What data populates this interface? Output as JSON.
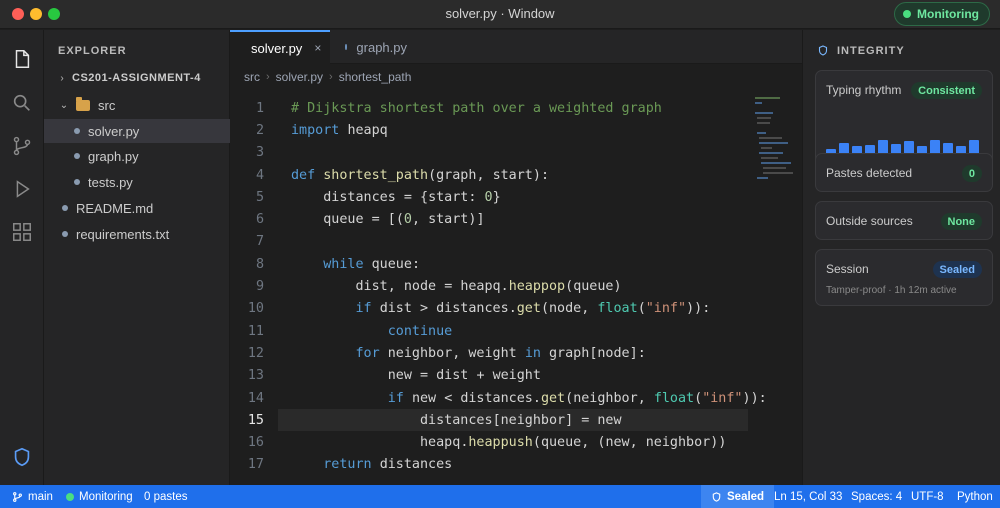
{
  "window": {
    "title": "solver.py · Window",
    "monitoring_label": "Monitoring"
  },
  "activity_bar": {
    "icons": [
      "files-icon",
      "search-icon",
      "source-control-icon",
      "run-icon",
      "extensions-icon",
      "shield-icon"
    ]
  },
  "explorer": {
    "title": "EXPLORER",
    "project": "CS201-ASSIGNMENT-4",
    "items": [
      {
        "label": "src",
        "type": "folder"
      },
      {
        "label": "solver.py",
        "type": "file",
        "active": true
      },
      {
        "label": "graph.py",
        "type": "file"
      },
      {
        "label": "tests.py",
        "type": "file"
      },
      {
        "label": "README.md",
        "type": "file"
      },
      {
        "label": "requirements.txt",
        "type": "file"
      }
    ]
  },
  "tabs": [
    {
      "label": "solver.py",
      "close": "×"
    },
    {
      "label": "graph.py"
    }
  ],
  "breadcrumb": [
    "src",
    "solver.py",
    "shortest_path"
  ],
  "editor": {
    "current_line": 15,
    "lines": [
      "# Dijkstra shortest path over a weighted graph",
      "import heapq",
      "",
      "def shortest_path(graph, start):",
      "    distances = {start: 0}",
      "    queue = [(0, start)]",
      "",
      "    while queue:",
      "        dist, node = heapq.heappop(queue)",
      "        if dist > distances.get(node, float(\"inf\")):",
      "            continue",
      "        for neighbor, weight in graph[node]:",
      "            new = dist + weight",
      "            if new < distances.get(neighbor, float(\"inf\")):",
      "                distances[neighbor] = new",
      "                heapq.heappush(queue, (new, neighbor))",
      "    return distances"
    ]
  },
  "integrity": {
    "title": "INTEGRITY",
    "typing": {
      "label": "Typing rhythm",
      "badge": "Consistent",
      "levels": [
        0.45,
        0.75,
        0.6,
        0.65,
        0.85,
        0.7,
        0.8,
        0.6,
        0.85,
        0.75,
        0.6,
        0.85
      ]
    },
    "pastes": {
      "label": "Pastes detected",
      "badge": "0"
    },
    "sources": {
      "label": "Outside sources",
      "badge": "None"
    },
    "session": {
      "label": "Session",
      "badge": "Sealed",
      "sub": "Tamper-proof · 1h 12m active"
    }
  },
  "statusbar": {
    "branch": "main",
    "monitoring": "Monitoring",
    "pastes": "0 pastes",
    "sealed": "Sealed",
    "position": "Ln 15, Col 33",
    "spaces": "Spaces: 4",
    "encoding": "UTF-8",
    "language": "Python"
  },
  "colors": {
    "accent": "#1f6feb",
    "green": "#4ade80",
    "bar": "#3b82f6"
  }
}
